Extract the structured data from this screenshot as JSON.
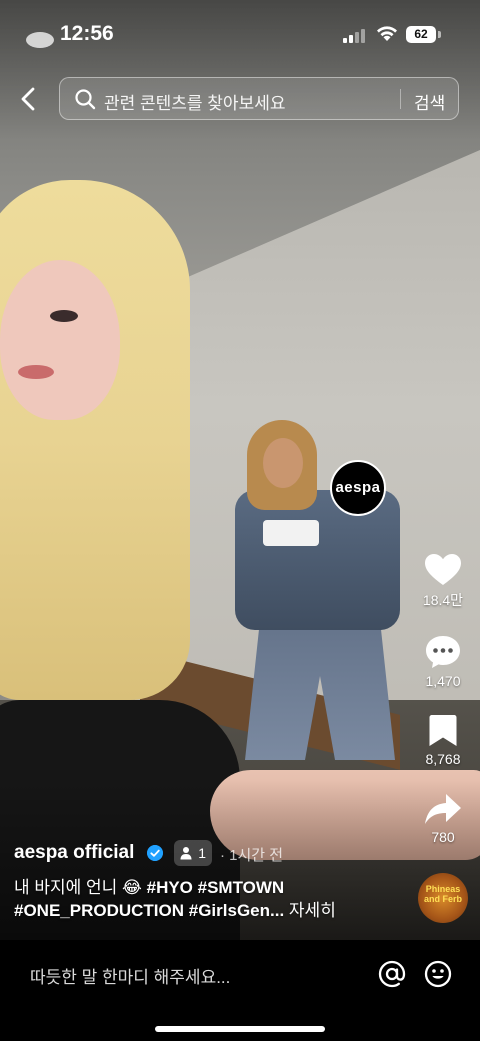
{
  "status_bar": {
    "time": "12:56",
    "battery": "62"
  },
  "search": {
    "placeholder": "관련 콘텐츠를 찾아보세요",
    "button_label": "검색"
  },
  "creator": {
    "avatar_text": "aespa",
    "name": "aespa official",
    "collab_count": "1",
    "posted": "· 1시간 전"
  },
  "actions": {
    "likes": "18.4만",
    "comments": "1,470",
    "saves": "8,768",
    "shares": "780"
  },
  "caption": {
    "text_prefix": "내 바지에 언니 😂 ",
    "hashtags_line1": "#HYO #SMTOWN",
    "hashtags_line2": "#ONE_PRODUCTION #GirlsGen...",
    "more": "자세히"
  },
  "music": {
    "label": "Phineas and Ferb"
  },
  "comment_bar": {
    "placeholder": "따듯한 말 한마디 해주세요..."
  },
  "colors": {
    "verified": "#20a1ff",
    "comment_bar_bg": "#000000"
  }
}
